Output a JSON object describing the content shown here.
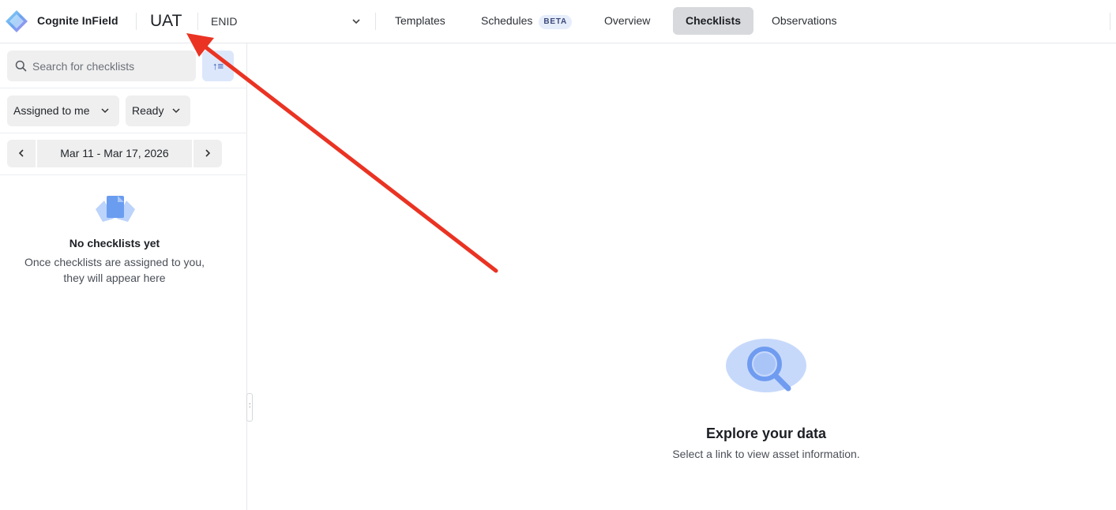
{
  "header": {
    "brand": "Cognite InField",
    "environment": "UAT",
    "site": "ENID",
    "nav": [
      {
        "label": "Templates",
        "active": false
      },
      {
        "label": "Schedules",
        "badge": "BETA",
        "active": false
      },
      {
        "label": "Overview",
        "active": false
      },
      {
        "label": "Checklists",
        "active": true
      },
      {
        "label": "Observations",
        "active": false
      }
    ]
  },
  "sidebar": {
    "search_placeholder": "Search for checklists",
    "sort_label": "↑≡",
    "filters": {
      "assignee": "Assigned to me",
      "status": "Ready"
    },
    "date_range": "Mar 11 - Mar 17, 2026",
    "empty_title": "No checklists yet",
    "empty_description": "Once checklists are assigned to you, they will appear here"
  },
  "main": {
    "empty_title": "Explore your data",
    "empty_description": "Select a link to view asset information."
  },
  "colors": {
    "accent": "#4c7fe8",
    "annotation_arrow": "#ea3323",
    "active_tab_bg": "#d7d9dc"
  }
}
